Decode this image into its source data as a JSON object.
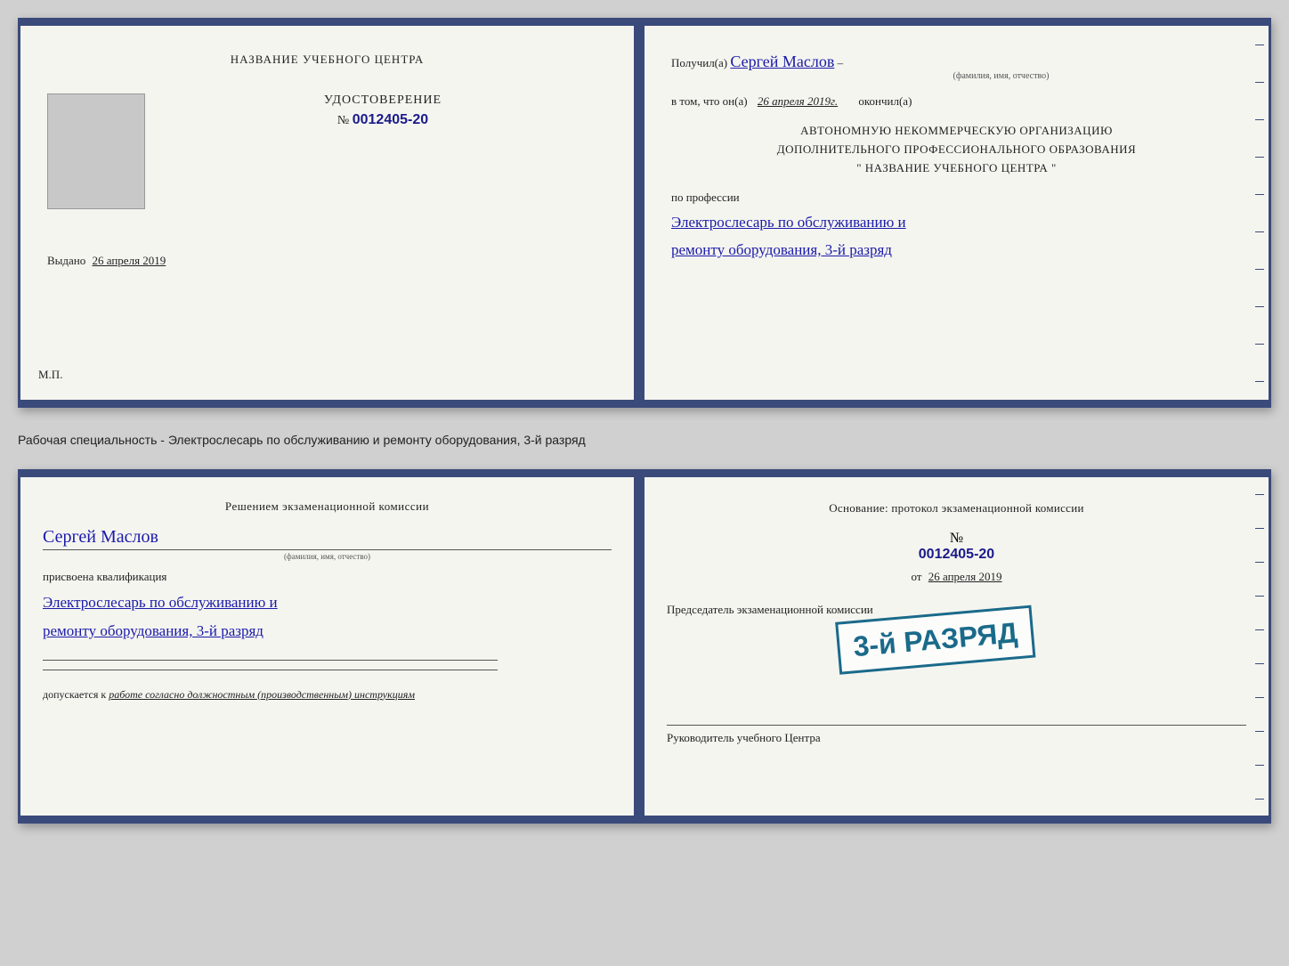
{
  "doc1": {
    "left": {
      "header": "НАЗВАНИЕ УЧЕБНОГО ЦЕНТРА",
      "udostoverenie_label": "УДОСТОВЕРЕНИЕ",
      "number_prefix": "№",
      "number": "0012405-20",
      "vydano_label": "Выдано",
      "vydano_date": "26 апреля 2019",
      "mp_label": "М.П."
    },
    "right": {
      "poluchil_label": "Получил(а)",
      "recipient_name": "Сергей Маслов",
      "fio_sub": "(фамилия, имя, отчество)",
      "vtom_label": "в том, что он(а)",
      "vtom_date": "26 апреля 2019г.",
      "okonchil_label": "окончил(а)",
      "org_line1": "АВТОНОМНУЮ НЕКОММЕРЧЕСКУЮ ОРГАНИЗАЦИЮ",
      "org_line2": "ДОПОЛНИТЕЛЬНОГО ПРОФЕССИОНАЛЬНОГО ОБРАЗОВАНИЯ",
      "org_line3": "\"   НАЗВАНИЕ УЧЕБНОГО ЦЕНТРА   \"",
      "po_professii_label": "по профессии",
      "profession_line1": "Электрослесарь по обслуживанию и",
      "profession_line2": "ремонту оборудования, 3-й разряд"
    }
  },
  "between_text": "Рабочая специальность - Электрослесарь по обслуживанию и ремонту оборудования, 3-й разряд",
  "doc2": {
    "left": {
      "resheniem_label": "Решением экзаменационной комиссии",
      "person_name": "Сергей Маслов",
      "fio_sub": "(фамилия, имя, отчество)",
      "prisvoena_label": "присвоена квалификация",
      "qualification_line1": "Электрослесарь по обслуживанию и",
      "qualification_line2": "ремонту оборудования, 3-й разряд",
      "dopuskaetsya_label": "допускается к",
      "dopusk_value": "работе согласно должностным (производственным) инструкциям"
    },
    "right": {
      "osnovanie_label": "Основание: протокол экзаменационной комиссии",
      "number_prefix": "№",
      "protocol_number": "0012405-20",
      "ot_prefix": "от",
      "ot_date": "26 апреля 2019",
      "chairman_label": "Председатель экзаменационной комиссии",
      "rukovoditel_label": "Руководитель учебного Центра"
    },
    "stamp": {
      "text": "3-й РАЗРЯД"
    }
  }
}
